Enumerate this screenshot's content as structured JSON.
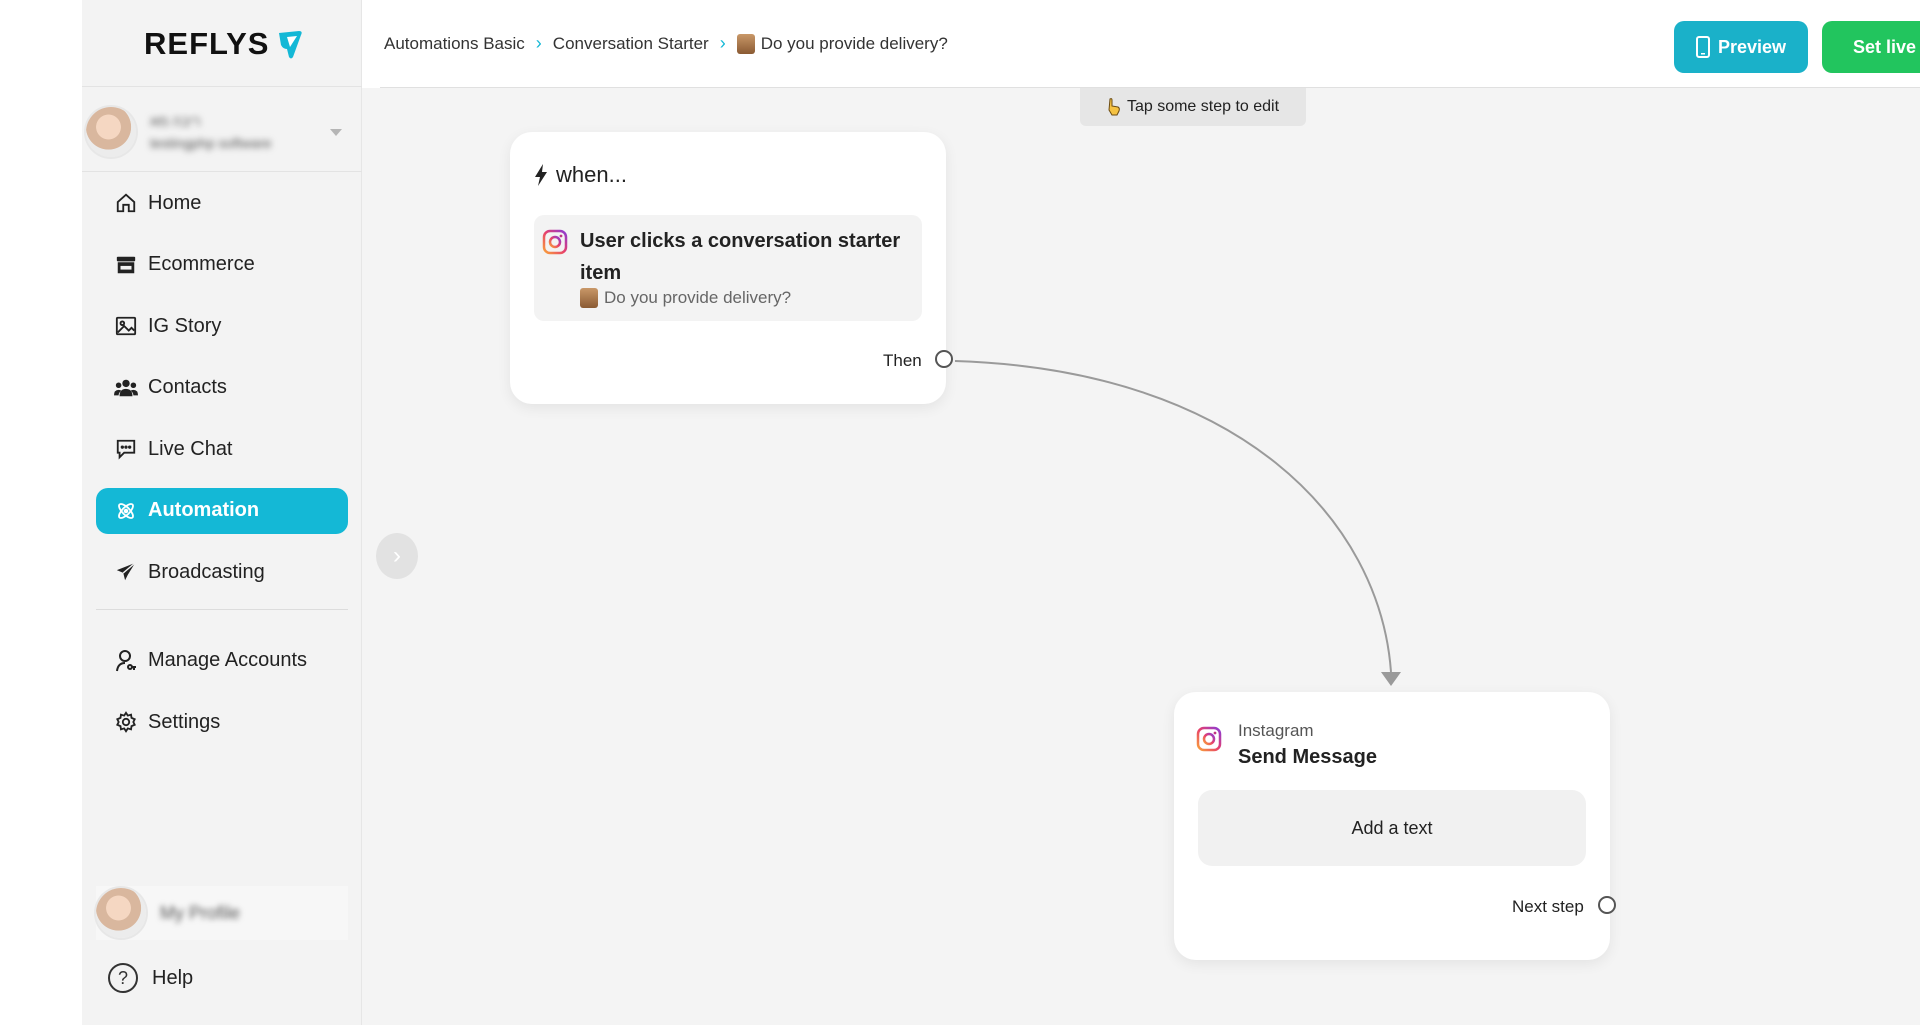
{
  "brand": {
    "name": "REFLYS",
    "accent": "#14b8d6"
  },
  "account": {
    "name_line1": "ריבה מא",
    "name_line2": "testingphp software"
  },
  "nav": {
    "items": [
      {
        "label": "Home",
        "icon": "home-icon"
      },
      {
        "label": "Ecommerce",
        "icon": "store-icon"
      },
      {
        "label": "IG Story",
        "icon": "image-icon"
      },
      {
        "label": "Contacts",
        "icon": "users-icon"
      },
      {
        "label": "Live Chat",
        "icon": "chat-icon"
      },
      {
        "label": "Automation",
        "icon": "atom-icon",
        "active": true
      },
      {
        "label": "Broadcasting",
        "icon": "send-icon"
      }
    ],
    "secondary": [
      {
        "label": "Manage Accounts",
        "icon": "user-key-icon"
      },
      {
        "label": "Settings",
        "icon": "gear-icon"
      }
    ]
  },
  "profile": {
    "name": "My Profile"
  },
  "help": {
    "label": "Help"
  },
  "breadcrumb": {
    "items": [
      "Automations Basic",
      "Conversation Starter",
      "Do you provide delivery?"
    ]
  },
  "toolbar": {
    "preview_label": "Preview",
    "set_live_label": "Set live"
  },
  "canvas": {
    "hint": "Tap some step to edit",
    "when_card": {
      "title": "when...",
      "trigger_title": "User clicks a conversation starter item",
      "trigger_subtitle": "Do you provide delivery?",
      "port_label": "Then"
    },
    "send_card": {
      "platform": "Instagram",
      "title": "Send Message",
      "add_text_label": "Add a text",
      "port_label": "Next step"
    }
  },
  "colors": {
    "preview": "#1ab1c9",
    "set_live": "#22c55e",
    "canvas_bg": "#f4f4f4"
  }
}
